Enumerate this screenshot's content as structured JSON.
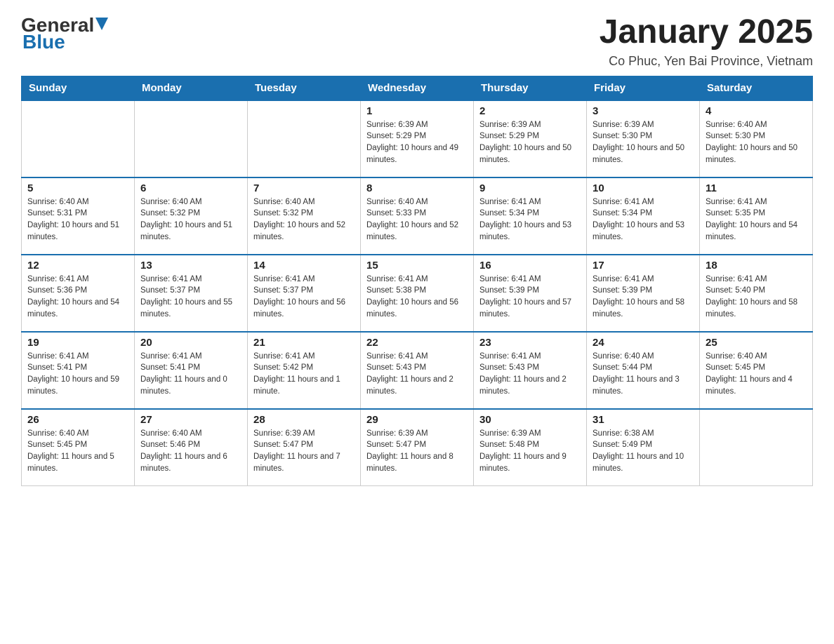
{
  "header": {
    "logo_general": "General",
    "logo_blue": "Blue",
    "month_title": "January 2025",
    "location": "Co Phuc, Yen Bai Province, Vietnam"
  },
  "days_of_week": [
    "Sunday",
    "Monday",
    "Tuesday",
    "Wednesday",
    "Thursday",
    "Friday",
    "Saturday"
  ],
  "weeks": [
    [
      {
        "day": "",
        "info": ""
      },
      {
        "day": "",
        "info": ""
      },
      {
        "day": "",
        "info": ""
      },
      {
        "day": "1",
        "info": "Sunrise: 6:39 AM\nSunset: 5:29 PM\nDaylight: 10 hours and 49 minutes."
      },
      {
        "day": "2",
        "info": "Sunrise: 6:39 AM\nSunset: 5:29 PM\nDaylight: 10 hours and 50 minutes."
      },
      {
        "day": "3",
        "info": "Sunrise: 6:39 AM\nSunset: 5:30 PM\nDaylight: 10 hours and 50 minutes."
      },
      {
        "day": "4",
        "info": "Sunrise: 6:40 AM\nSunset: 5:30 PM\nDaylight: 10 hours and 50 minutes."
      }
    ],
    [
      {
        "day": "5",
        "info": "Sunrise: 6:40 AM\nSunset: 5:31 PM\nDaylight: 10 hours and 51 minutes."
      },
      {
        "day": "6",
        "info": "Sunrise: 6:40 AM\nSunset: 5:32 PM\nDaylight: 10 hours and 51 minutes."
      },
      {
        "day": "7",
        "info": "Sunrise: 6:40 AM\nSunset: 5:32 PM\nDaylight: 10 hours and 52 minutes."
      },
      {
        "day": "8",
        "info": "Sunrise: 6:40 AM\nSunset: 5:33 PM\nDaylight: 10 hours and 52 minutes."
      },
      {
        "day": "9",
        "info": "Sunrise: 6:41 AM\nSunset: 5:34 PM\nDaylight: 10 hours and 53 minutes."
      },
      {
        "day": "10",
        "info": "Sunrise: 6:41 AM\nSunset: 5:34 PM\nDaylight: 10 hours and 53 minutes."
      },
      {
        "day": "11",
        "info": "Sunrise: 6:41 AM\nSunset: 5:35 PM\nDaylight: 10 hours and 54 minutes."
      }
    ],
    [
      {
        "day": "12",
        "info": "Sunrise: 6:41 AM\nSunset: 5:36 PM\nDaylight: 10 hours and 54 minutes."
      },
      {
        "day": "13",
        "info": "Sunrise: 6:41 AM\nSunset: 5:37 PM\nDaylight: 10 hours and 55 minutes."
      },
      {
        "day": "14",
        "info": "Sunrise: 6:41 AM\nSunset: 5:37 PM\nDaylight: 10 hours and 56 minutes."
      },
      {
        "day": "15",
        "info": "Sunrise: 6:41 AM\nSunset: 5:38 PM\nDaylight: 10 hours and 56 minutes."
      },
      {
        "day": "16",
        "info": "Sunrise: 6:41 AM\nSunset: 5:39 PM\nDaylight: 10 hours and 57 minutes."
      },
      {
        "day": "17",
        "info": "Sunrise: 6:41 AM\nSunset: 5:39 PM\nDaylight: 10 hours and 58 minutes."
      },
      {
        "day": "18",
        "info": "Sunrise: 6:41 AM\nSunset: 5:40 PM\nDaylight: 10 hours and 58 minutes."
      }
    ],
    [
      {
        "day": "19",
        "info": "Sunrise: 6:41 AM\nSunset: 5:41 PM\nDaylight: 10 hours and 59 minutes."
      },
      {
        "day": "20",
        "info": "Sunrise: 6:41 AM\nSunset: 5:41 PM\nDaylight: 11 hours and 0 minutes."
      },
      {
        "day": "21",
        "info": "Sunrise: 6:41 AM\nSunset: 5:42 PM\nDaylight: 11 hours and 1 minute."
      },
      {
        "day": "22",
        "info": "Sunrise: 6:41 AM\nSunset: 5:43 PM\nDaylight: 11 hours and 2 minutes."
      },
      {
        "day": "23",
        "info": "Sunrise: 6:41 AM\nSunset: 5:43 PM\nDaylight: 11 hours and 2 minutes."
      },
      {
        "day": "24",
        "info": "Sunrise: 6:40 AM\nSunset: 5:44 PM\nDaylight: 11 hours and 3 minutes."
      },
      {
        "day": "25",
        "info": "Sunrise: 6:40 AM\nSunset: 5:45 PM\nDaylight: 11 hours and 4 minutes."
      }
    ],
    [
      {
        "day": "26",
        "info": "Sunrise: 6:40 AM\nSunset: 5:45 PM\nDaylight: 11 hours and 5 minutes."
      },
      {
        "day": "27",
        "info": "Sunrise: 6:40 AM\nSunset: 5:46 PM\nDaylight: 11 hours and 6 minutes."
      },
      {
        "day": "28",
        "info": "Sunrise: 6:39 AM\nSunset: 5:47 PM\nDaylight: 11 hours and 7 minutes."
      },
      {
        "day": "29",
        "info": "Sunrise: 6:39 AM\nSunset: 5:47 PM\nDaylight: 11 hours and 8 minutes."
      },
      {
        "day": "30",
        "info": "Sunrise: 6:39 AM\nSunset: 5:48 PM\nDaylight: 11 hours and 9 minutes."
      },
      {
        "day": "31",
        "info": "Sunrise: 6:38 AM\nSunset: 5:49 PM\nDaylight: 11 hours and 10 minutes."
      },
      {
        "day": "",
        "info": ""
      }
    ]
  ]
}
